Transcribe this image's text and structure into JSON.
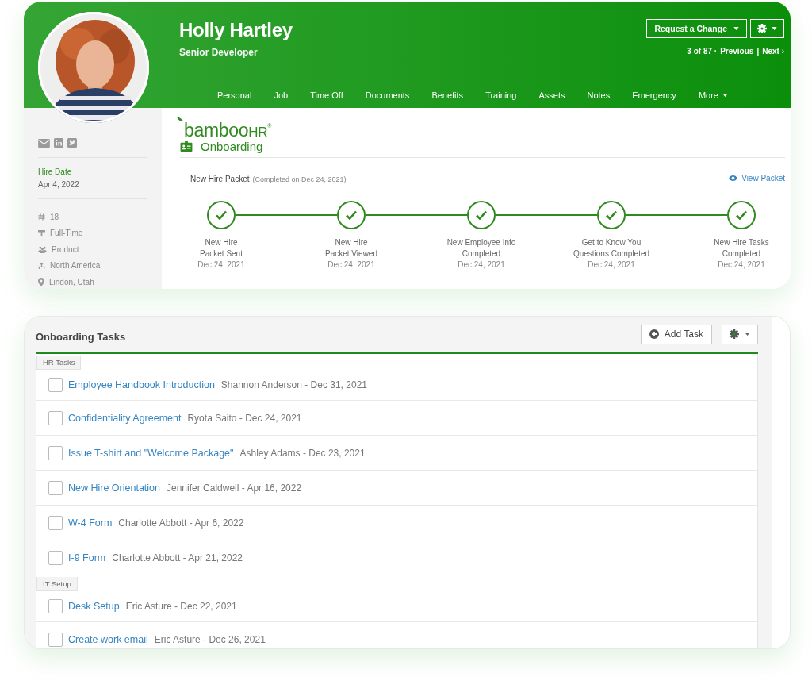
{
  "profile": {
    "name": "Holly Hartley",
    "job_title": "Senior Developer"
  },
  "actions": {
    "request_button": "Request a Change",
    "pager": {
      "position": "3 of 87 ·",
      "previous": "Previous",
      "separator": "|",
      "next": "Next ›"
    }
  },
  "tabs": [
    {
      "label": "Personal",
      "selected": false,
      "dropdown": false
    },
    {
      "label": "Job",
      "selected": false,
      "dropdown": false
    },
    {
      "label": "Time Off",
      "selected": false,
      "dropdown": false
    },
    {
      "label": "Documents",
      "selected": false,
      "dropdown": false
    },
    {
      "label": "Benefits",
      "selected": false,
      "dropdown": false
    },
    {
      "label": "Training",
      "selected": false,
      "dropdown": false
    },
    {
      "label": "Assets",
      "selected": false,
      "dropdown": false
    },
    {
      "label": "Notes",
      "selected": false,
      "dropdown": false
    },
    {
      "label": "Emergency",
      "selected": false,
      "dropdown": false
    },
    {
      "label": "More",
      "selected": false,
      "dropdown": true
    }
  ],
  "sidebar": {
    "hire_date_label": "Hire Date",
    "hire_date": "Apr 4, 2022",
    "details": [
      {
        "kind": "number",
        "text": "18"
      },
      {
        "kind": "employment",
        "text": "Full-Time"
      },
      {
        "kind": "department",
        "text": "Product"
      },
      {
        "kind": "division",
        "text": "North America"
      },
      {
        "kind": "location",
        "text": "Lindon, Utah"
      }
    ]
  },
  "logo": {
    "text": "bamboo",
    "suffix": "HR",
    "mark": "®"
  },
  "section_title": "Onboarding",
  "packet": {
    "title": "New Hire Packet",
    "status": "(Completed on Dec 24, 2021)",
    "link": "View Packet",
    "steps": [
      {
        "label": "New Hire\nPacket Sent",
        "date": "Dec 24, 2021",
        "completed": true
      },
      {
        "label": "New Hire\nPacket Viewed",
        "date": "Dec 24, 2021",
        "completed": true
      },
      {
        "label": "New Employee Info\nCompleted",
        "date": "Dec 24, 2021",
        "completed": true
      },
      {
        "label": "Get to Know You\nQuestions Completed",
        "date": "Dec 24, 2021",
        "completed": true
      },
      {
        "label": "New Hire Tasks\nCompleted",
        "date": "Dec 24, 2021",
        "completed": true
      }
    ]
  },
  "tasks": {
    "title": "Onboarding Tasks",
    "add_button": "Add Task",
    "groups": [
      {
        "name": "HR Tasks",
        "items": [
          {
            "title": "Employee Handbook Introduction",
            "meta": "Shannon Anderson - Dec 31, 2021",
            "checked": false
          },
          {
            "title": "Confidentiality Agreement",
            "meta": "Ryota Saito - Dec 24, 2021",
            "checked": false
          },
          {
            "title": "Issue T-shirt and \"Welcome Package\"",
            "meta": "Ashley Adams - Dec 23, 2021",
            "checked": false
          },
          {
            "title": "New Hire Orientation",
            "meta": "Jennifer Caldwell - Apr 16, 2022",
            "checked": false
          },
          {
            "title": "W-4 Form",
            "meta": "Charlotte Abbott - Apr 6, 2022",
            "checked": false
          },
          {
            "title": "I-9 Form",
            "meta": "Charlotte Abbott - Apr 21, 2022",
            "checked": false
          }
        ]
      },
      {
        "name": "IT Setup",
        "items": [
          {
            "title": "Desk Setup",
            "meta": "Eric Asture - Dec 22, 2021",
            "checked": false
          },
          {
            "title": "Create work email",
            "meta": "Eric Asture - Dec 26, 2021",
            "checked": false
          }
        ]
      }
    ]
  }
}
